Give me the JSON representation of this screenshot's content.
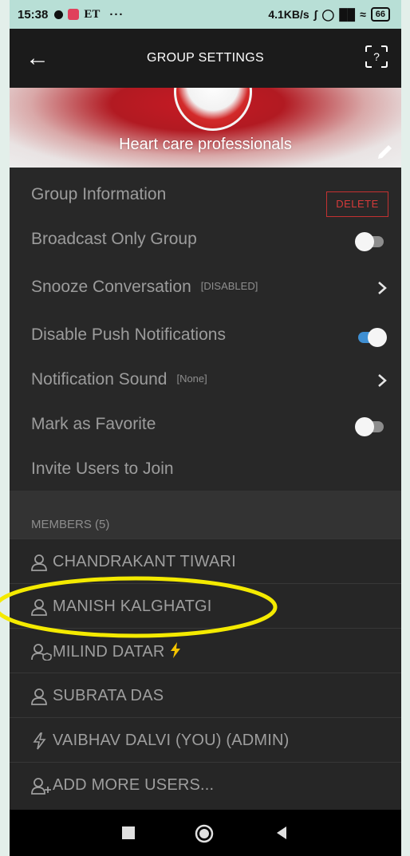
{
  "status_bar": {
    "time": "15:38",
    "et_label": "ET",
    "overflow_dots": "···",
    "network_speed": "4.1KB/s",
    "battery": "66"
  },
  "header": {
    "title": "GROUP SETTINGS"
  },
  "banner": {
    "group_name": "Heart care professionals"
  },
  "settings": {
    "group_information": "Group Information",
    "delete_label": "DELETE",
    "broadcast_only": "Broadcast Only Group",
    "broadcast_only_on": false,
    "snooze": "Snooze Conversation",
    "snooze_status": "[DISABLED]",
    "disable_push": "Disable Push Notifications",
    "disable_push_on": true,
    "notification_sound": "Notification Sound",
    "notification_sound_value": "[None]",
    "mark_favorite": "Mark as Favorite",
    "mark_favorite_on": false,
    "invite_users": "Invite Users to Join"
  },
  "members": {
    "header": "MEMBERS (5)",
    "items": [
      {
        "name": "CHANDRAKANT TIWARI",
        "icon": "person-icon"
      },
      {
        "name": "MANISH KALGHATGI",
        "icon": "person-icon"
      },
      {
        "name": "MILIND DATAR",
        "icon": "person-shield-icon"
      },
      {
        "name": "SUBRATA DAS",
        "icon": "person-icon"
      },
      {
        "name": "VAIBHAV  DALVI  (YOU)  (ADMIN)",
        "icon": "bolt-outline-icon"
      }
    ],
    "add_more": "ADD MORE USERS..."
  },
  "colors": {
    "accent_blue": "#3f8fd2",
    "delete_red": "#d63a3a",
    "highlight_yellow": "#f4ea00",
    "bolt_yellow": "#f4c400"
  }
}
